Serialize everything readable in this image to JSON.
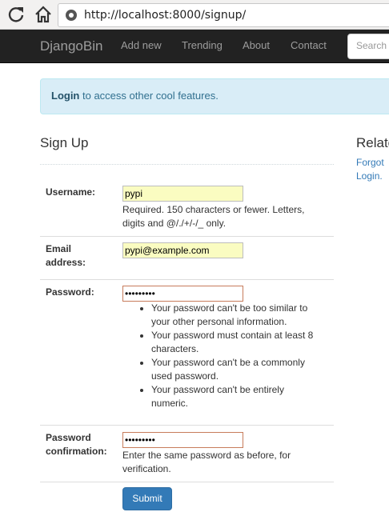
{
  "browser": {
    "url": "http://localhost:8000/signup/"
  },
  "navbar": {
    "brand": "DjangoBin",
    "items": [
      "Add new",
      "Trending",
      "About",
      "Contact"
    ],
    "search_placeholder": "Search"
  },
  "alert": {
    "login_link": "Login",
    "message": " to access other cool features."
  },
  "main": {
    "title": "Sign Up",
    "form": {
      "username": {
        "label": "Username:",
        "value": "pypi",
        "help": "Required. 150 characters or fewer. Letters, digits and @/./+/-/_ only."
      },
      "email": {
        "label_line1": "Email",
        "label_line2": "address:",
        "value": "pypi@example.com"
      },
      "password1": {
        "label": "Password:",
        "value": "•••••••••",
        "help_items": [
          "Your password can't be too similar to your other personal information.",
          "Your password must contain at least 8 characters.",
          "Your password can't be a commonly used password.",
          "Your password can't be entirely numeric."
        ]
      },
      "password2": {
        "label_line1": "Password",
        "label_line2": "confirmation:",
        "value": "•••••••••",
        "help": "Enter the same password as before, for verification."
      },
      "submit_label": "Submit"
    }
  },
  "sidebar": {
    "title": "Related",
    "links": [
      "Forgot",
      "Login."
    ]
  }
}
